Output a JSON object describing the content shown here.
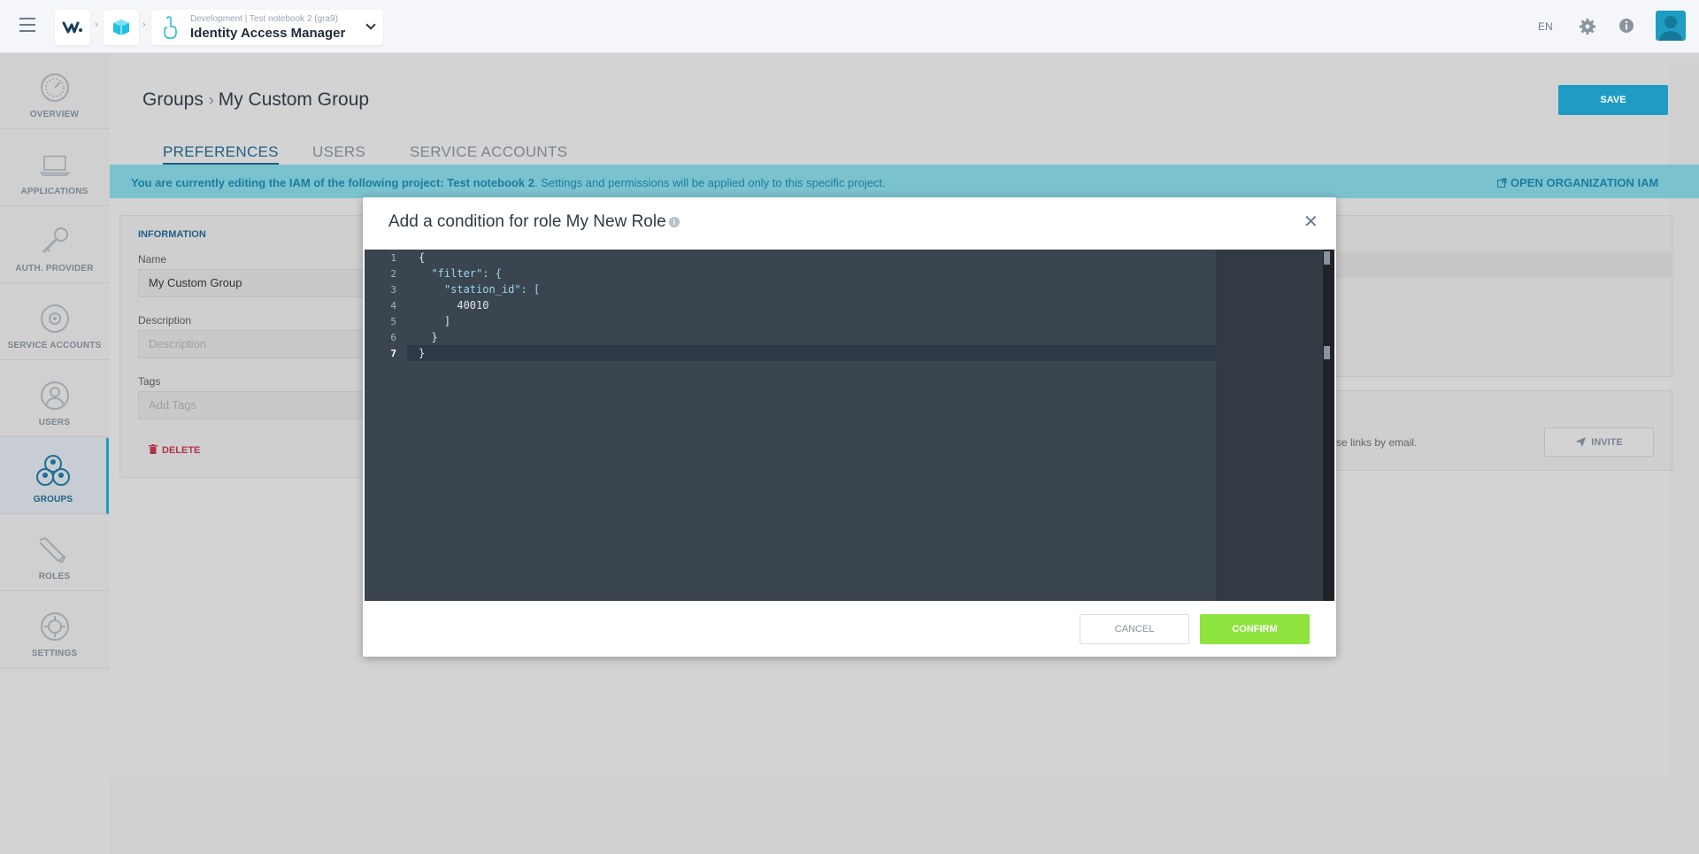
{
  "topbar": {
    "project_env": "Development | Test notebook 2 (gra9)",
    "project_title": "Identity Access Manager",
    "language": "EN"
  },
  "sidebar": {
    "items": [
      {
        "label": "OVERVIEW",
        "icon": "speedometer-icon"
      },
      {
        "label": "APPLICATIONS",
        "icon": "laptop-icon"
      },
      {
        "label": "AUTH. PROVIDER",
        "icon": "key-icon"
      },
      {
        "label": "SERVICE ACCOUNTS",
        "icon": "service-account-icon"
      },
      {
        "label": "USERS",
        "icon": "user-icon"
      },
      {
        "label": "GROUPS",
        "icon": "groups-icon",
        "active": true
      },
      {
        "label": "ROLES",
        "icon": "pencil-icon"
      },
      {
        "label": "SETTINGS",
        "icon": "gear-icon"
      }
    ]
  },
  "page": {
    "breadcrumb_root": "Groups",
    "breadcrumb_current": "My Custom Group",
    "save_label": "SAVE",
    "tabs": [
      "PREFERENCES",
      "USERS",
      "SERVICE ACCOUNTS"
    ],
    "active_tab": "PREFERENCES"
  },
  "banner": {
    "text_bold": "You are currently editing the IAM of the following project: Test notebook 2",
    "text_rest": ". Settings and permissions will be applied only to this specific project.",
    "link": "OPEN ORGANIZATION IAM"
  },
  "info_card": {
    "heading": "INFORMATION",
    "name_label": "Name",
    "name_value": "My Custom Group",
    "description_label": "Description",
    "description_placeholder": "Description",
    "tags_label": "Tags",
    "tags_placeholder": "Add Tags",
    "delete_label": "DELETE"
  },
  "invite_card": {
    "partial_text": "se links by email.",
    "invite_label": "INVITE"
  },
  "modal": {
    "title": "Add a condition for role My New Role",
    "info_glyph": "i",
    "close_glyph": "✕",
    "cancel_label": "CANCEL",
    "confirm_label": "CONFIRM",
    "active_line": 7,
    "code_lines": [
      "{",
      "  \"filter\": {",
      "    \"station_id\": [",
      "      40010",
      "    ]",
      "  }",
      "}"
    ]
  },
  "colors": {
    "accent": "#1e9cc4",
    "confirm": "#8ee33f",
    "delete": "#b5334a",
    "editor_bg": "#3b4550"
  }
}
